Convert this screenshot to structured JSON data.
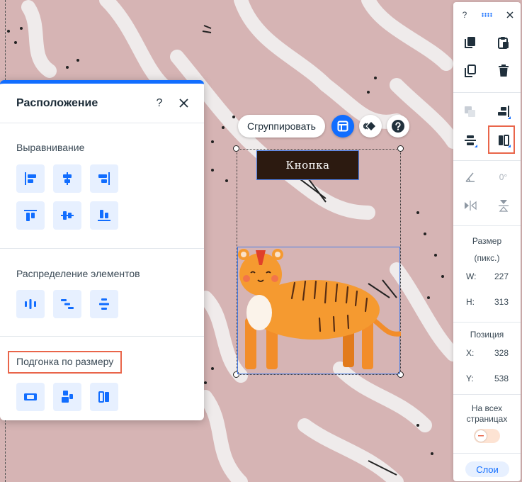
{
  "canvas": {
    "button_label": "Кнопка",
    "float_toolbar": {
      "group_label": "Сгруппировать",
      "layout_icon": "layout-icon",
      "animation_icon": "animation-icon",
      "help_icon": "help-icon"
    }
  },
  "arrange_panel": {
    "title": "Расположение",
    "help_label": "?",
    "align_title": "Выравнивание",
    "distribute_title": "Распределение элементов",
    "fit_title": "Подгонка по размеру"
  },
  "right_toolbar": {
    "help_label": "?",
    "rotation_value": "0°",
    "size_title": "Размер",
    "size_unit": "(пикс.)",
    "width_label": "W:",
    "width_value": "227",
    "height_label": "H:",
    "height_value": "313",
    "position_title": "Позиция",
    "x_label": "X:",
    "x_value": "328",
    "y_label": "Y:",
    "y_value": "538",
    "all_pages_label": "На всех страницах",
    "all_pages_on": false,
    "layers_label": "Слои"
  },
  "colors": {
    "accent": "#116dff",
    "highlight": "#e9654a",
    "canvas_bg": "#d6b4b4",
    "button_bg": "#2c1a10"
  }
}
